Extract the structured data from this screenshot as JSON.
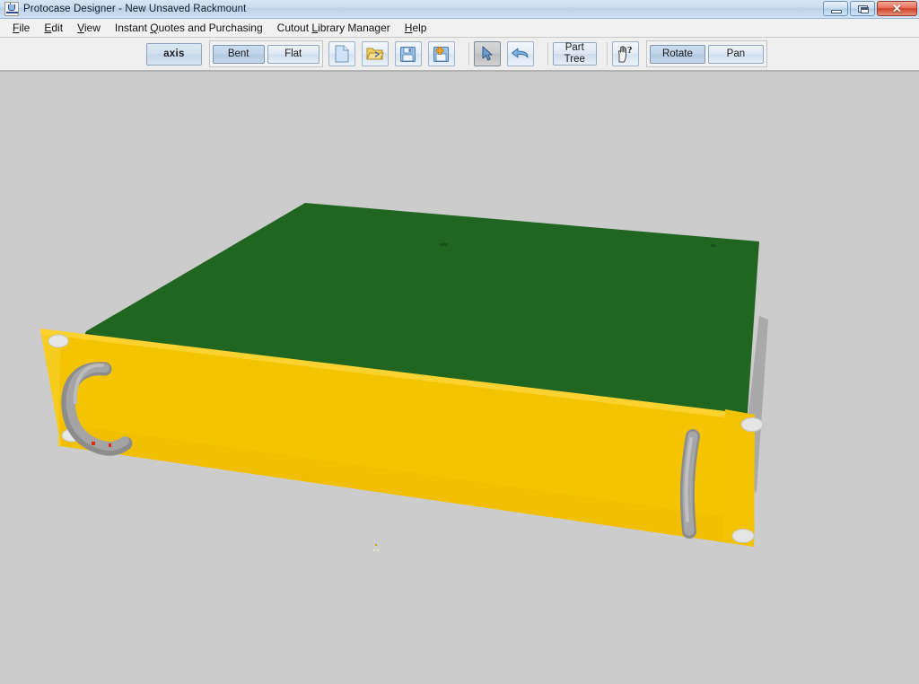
{
  "window": {
    "title": "Protocase Designer - New Unsaved Rackmount",
    "app_icon": "java-coffee-cup-icon",
    "controls": {
      "minimize": "Minimize",
      "restore": "Restore",
      "close": "Close"
    }
  },
  "menubar": {
    "items": [
      {
        "label": "File",
        "mnemonic": "F"
      },
      {
        "label": "Edit",
        "mnemonic": "E"
      },
      {
        "label": "View",
        "mnemonic": "V"
      },
      {
        "label": "Instant Quotes and Purchasing",
        "mnemonic": "Q"
      },
      {
        "label": "Cutout Library Manager",
        "mnemonic": "L"
      },
      {
        "label": "Help",
        "mnemonic": "H"
      }
    ]
  },
  "toolbar": {
    "axis_label": "axis",
    "view_mode": {
      "bent_label": "Bent",
      "flat_label": "Flat",
      "selected": "Bent"
    },
    "file_icons": [
      {
        "name": "new-document-icon",
        "tooltip": "New"
      },
      {
        "name": "open-folder-icon",
        "tooltip": "Open"
      },
      {
        "name": "save-icon",
        "tooltip": "Save"
      },
      {
        "name": "save-as-icon",
        "tooltip": "Save As"
      }
    ],
    "tool_icons": [
      {
        "name": "select-arrow-icon",
        "tooltip": "Select",
        "active": true
      },
      {
        "name": "undo-arrow-icon",
        "tooltip": "Undo",
        "active": false
      }
    ],
    "part_tree_label_line1": "Part",
    "part_tree_label_line2": "Tree",
    "context_help_icon": "hand-question-help-icon",
    "navigation": {
      "rotate_label": "Rotate",
      "pan_label": "Pan",
      "selected": "Rotate"
    }
  },
  "viewport": {
    "background_color": "#cccccc",
    "model": {
      "name": "rackmount-chassis",
      "top_panel_color": "#206620",
      "front_panel_color": "#f5c400",
      "front_panel_shade_color": "#edb900",
      "edge_color": "#a8a8a8",
      "handle_color": "#9a9a9a",
      "hole_color": "#e2e2e2",
      "marker_color": "#e03010",
      "parts": [
        {
          "name": "top-panel",
          "color": "#206620"
        },
        {
          "name": "front-panel",
          "color": "#f5c400"
        },
        {
          "name": "left-handle",
          "color": "#9a9a9a"
        },
        {
          "name": "right-handle",
          "color": "#9a9a9a"
        },
        {
          "name": "side-edge",
          "color": "#a8a8a8"
        }
      ]
    }
  }
}
